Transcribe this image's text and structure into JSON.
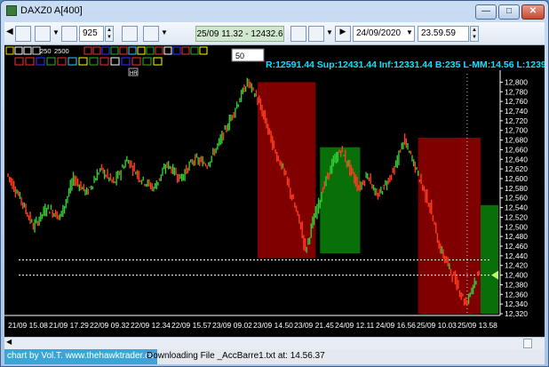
{
  "window": {
    "title": "DAXZ0 A[400]"
  },
  "toolbar": {
    "bars_value": "925",
    "range_label": "25/09 11.32 - 12432.6",
    "date_value": "24/09/2020",
    "time_value": "23.59.59"
  },
  "overlay": {
    "period_input": "50",
    "counts_a": "250",
    "counts_b": "2500",
    "hr_label": "HR",
    "stats_text": "R:12591.44 Sup:12431.44 Inf:12331.44 B:235 L-MM:14.56 L:12396"
  },
  "chart_data": {
    "type": "candlestick",
    "ylim": [
      12320,
      12810
    ],
    "y_ticks": [
      "12,800",
      "12,780",
      "12,760",
      "12,740",
      "12,720",
      "12,700",
      "12,680",
      "12,660",
      "12,640",
      "12,620",
      "12,600",
      "12,580",
      "12,560",
      "12,540",
      "12,520",
      "12,500",
      "12,480",
      "12,460",
      "12,440",
      "12,420",
      "12,400",
      "12,380",
      "12,360",
      "12,340",
      "12,320"
    ],
    "x_ticks": [
      "21/09 15.08",
      "21/09 17.29",
      "22/09 09.32",
      "22/09 12.34",
      "22/09 15.57",
      "23/09 09.02",
      "23/09 14.50",
      "23/09 21.45",
      "24/09 12.11",
      "24/09 16.56",
      "25/09 10.03",
      "25/09 13.58"
    ],
    "price_path": [
      [
        0,
        12610
      ],
      [
        3,
        12560
      ],
      [
        6,
        12500
      ],
      [
        9,
        12540
      ],
      [
        12,
        12520
      ],
      [
        15,
        12600
      ],
      [
        18,
        12570
      ],
      [
        21,
        12620
      ],
      [
        24,
        12590
      ],
      [
        27,
        12640
      ],
      [
        30,
        12600
      ],
      [
        33,
        12580
      ],
      [
        36,
        12630
      ],
      [
        39,
        12600
      ],
      [
        42,
        12640
      ],
      [
        45,
        12630
      ],
      [
        48,
        12680
      ],
      [
        51,
        12740
      ],
      [
        54,
        12800
      ],
      [
        56,
        12770
      ],
      [
        58,
        12720
      ],
      [
        60,
        12660
      ],
      [
        62,
        12620
      ],
      [
        64,
        12560
      ],
      [
        66,
        12500
      ],
      [
        67,
        12450
      ],
      [
        69,
        12520
      ],
      [
        71,
        12580
      ],
      [
        73,
        12630
      ],
      [
        75,
        12660
      ],
      [
        77,
        12620
      ],
      [
        79,
        12580
      ],
      [
        81,
        12610
      ],
      [
        83,
        12560
      ],
      [
        85,
        12590
      ],
      [
        87,
        12620
      ],
      [
        89,
        12680
      ],
      [
        91,
        12640
      ],
      [
        93,
        12590
      ],
      [
        95,
        12540
      ],
      [
        97,
        12460
      ],
      [
        99,
        12420
      ],
      [
        101,
        12380
      ],
      [
        103,
        12340
      ],
      [
        105,
        12390
      ],
      [
        106,
        12400
      ]
    ],
    "zones": [
      {
        "color": "red",
        "x0": 56,
        "x1": 69,
        "y0": 12435,
        "y1": 12800
      },
      {
        "color": "green",
        "x0": 70,
        "x1": 79,
        "y0": 12445,
        "y1": 12665
      },
      {
        "color": "red",
        "x0": 92,
        "x1": 106,
        "y0": 12320,
        "y1": 12685
      },
      {
        "color": "green",
        "x0": 106,
        "x1": 110,
        "y0": 12320,
        "y1": 12545
      }
    ],
    "hlines": [
      12431.44,
      12400
    ],
    "vline_x": 103,
    "x_max": 110,
    "colors": {
      "up": "#33cc33",
      "down": "#ff3b1f",
      "axis_text": "#ffffff",
      "stats_text": "#00e5ff"
    }
  },
  "status": {
    "credit": "chart by Vol.T. www.thehawktrader.co",
    "message": "Downloading File _AccBarre1.txt at: 14.56.37"
  }
}
